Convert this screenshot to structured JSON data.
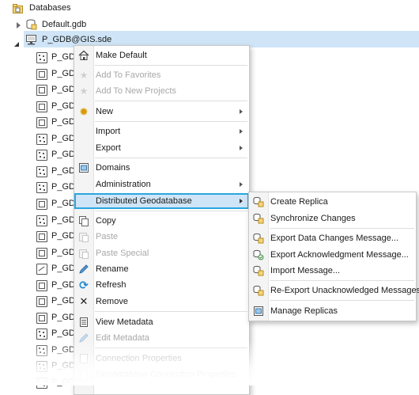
{
  "tree": {
    "databases_label": "Databases",
    "default_gdb_label": "Default.gdb",
    "sde_label": "P_GDB@GIS.sde",
    "child_label": "P_GDB",
    "children": [
      {
        "label": "P_GDB",
        "icon": "point-feature-class-icon"
      },
      {
        "label": "P_GDB",
        "icon": "polygon-feature-class-icon"
      },
      {
        "label": "P_GDB",
        "icon": "polygon-feature-class-icon"
      },
      {
        "label": "P_GDB",
        "icon": "polygon-feature-class-icon"
      },
      {
        "label": "P_GDB",
        "icon": "polygon-feature-class-icon"
      },
      {
        "label": "P_GDB",
        "icon": "point-feature-class-icon"
      },
      {
        "label": "P_GDB",
        "icon": "point-feature-class-icon"
      },
      {
        "label": "P_GDB",
        "icon": "point-feature-class-icon"
      },
      {
        "label": "P_GDB",
        "icon": "point-feature-class-icon"
      },
      {
        "label": "P_GDB",
        "icon": "polygon-feature-class-icon"
      },
      {
        "label": "P_GDB",
        "icon": "point-feature-class-icon"
      },
      {
        "label": "P_GDB",
        "icon": "polygon-feature-class-icon"
      },
      {
        "label": "P_GDB",
        "icon": "polygon-feature-class-icon"
      },
      {
        "label": "P_GDB",
        "icon": "line-feature-class-icon"
      },
      {
        "label": "P_GDB",
        "icon": "polygon-feature-class-icon"
      },
      {
        "label": "P_GDB",
        "icon": "polygon-feature-class-icon"
      },
      {
        "label": "P_GDB",
        "icon": "polygon-feature-class-icon"
      },
      {
        "label": "P_GDB",
        "icon": "point-feature-class-icon"
      },
      {
        "label": "P_GDB",
        "icon": "point-feature-class-icon"
      },
      {
        "label": "P_GDB",
        "icon": "point-feature-class-icon"
      },
      {
        "label": "P_GDB",
        "icon": "point-feature-class-icon"
      }
    ]
  },
  "context_menu": {
    "make_default": "Make Default",
    "add_to_favorites": "Add To Favorites",
    "add_to_new_projects": "Add To New Projects",
    "new": "New",
    "import": "Import",
    "export": "Export",
    "domains": "Domains",
    "administration": "Administration",
    "distributed_geodatabase": "Distributed Geodatabase",
    "copy": "Copy",
    "paste": "Paste",
    "paste_special": "Paste Special",
    "rename": "Rename",
    "refresh": "Refresh",
    "remove": "Remove",
    "view_metadata": "View Metadata",
    "edit_metadata": "Edit Metadata",
    "connection_properties": "Connection Properties",
    "partially_hidden_item": "Geodatabase Connection Properties"
  },
  "submenu": {
    "create_replica": "Create Replica",
    "synchronize_changes": "Synchronize Changes",
    "export_data_changes": "Export Data Changes Message...",
    "export_acknowledgment": "Export Acknowledgment Message...",
    "import_message": "Import Message...",
    "reexport_unacknowledged": "Re-Export Unacknowledged Messages...",
    "manage_replicas": "Manage Replicas"
  },
  "colors": {
    "selection": "#cfe5f7",
    "focus_border": "#2aa6e0",
    "disabled_text": "#a8a8a8",
    "refresh_blue": "#1e88d2",
    "star_gold": "#d79b00"
  }
}
